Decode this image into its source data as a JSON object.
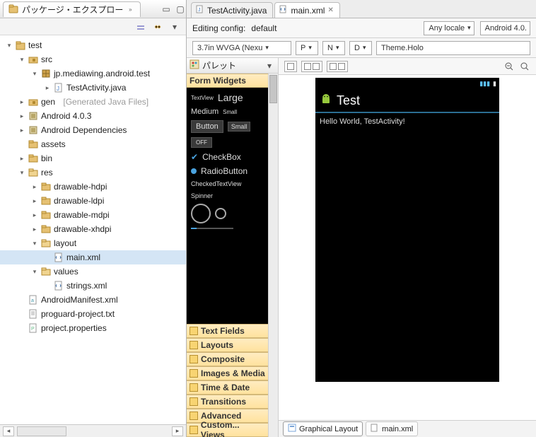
{
  "sidebar": {
    "title": "パッケージ・エクスプロー",
    "toolbar": {
      "menu": "▾"
    },
    "tree": {
      "n0": "test",
      "n1": "src",
      "n2": "jp.mediawing.android.test",
      "n3": "TestActivity.java",
      "n4": "gen",
      "n4_hint": "[Generated Java Files]",
      "n5": "Android 4.0.3",
      "n6": "Android Dependencies",
      "n7": "assets",
      "n8": "bin",
      "n9": "res",
      "n10": "drawable-hdpi",
      "n11": "drawable-ldpi",
      "n12": "drawable-mdpi",
      "n13": "drawable-xhdpi",
      "n14": "layout",
      "n15": "main.xml",
      "n16": "values",
      "n17": "strings.xml",
      "n18": "AndroidManifest.xml",
      "n19": "proguard-project.txt",
      "n20": "project.properties"
    }
  },
  "editor": {
    "tabs": {
      "t0": "TestActivity.java",
      "t1": "main.xml"
    },
    "config_label": "Editing config:",
    "config_value": "default",
    "locale": "Any locale",
    "platform": "Android 4.0.",
    "device": "3.7in WVGA (Nexu",
    "orient_p": "P",
    "orient_n": "N",
    "orient_d": "D",
    "theme": "Theme.Holo"
  },
  "palette": {
    "title": "パレット",
    "drawers": {
      "form_widgets": "Form Widgets",
      "text_fields": "Text Fields",
      "layouts": "Layouts",
      "composite": "Composite",
      "images": "Images & Media",
      "time": "Time & Date",
      "transitions": "Transitions",
      "advanced": "Advanced",
      "custom": "Custom... Views"
    },
    "widgets": {
      "textview": "TextView",
      "large": "Large",
      "medium": "Medium",
      "small": "Small",
      "button": "Button",
      "small_btn": "Small",
      "off": "OFF",
      "checkbox": "CheckBox",
      "radio": "RadioButton",
      "checked_tv": "CheckedTextView",
      "spinner": "Spinner"
    }
  },
  "canvas": {
    "app_title": "Test",
    "body_text": "Hello World, TestActivity!"
  },
  "bottom_tabs": {
    "graphical": "Graphical Layout",
    "xml": "main.xml"
  },
  "icons": {
    "project": "#cfa24a",
    "folder": "#e6c173",
    "folder_open": "#e6c173",
    "pkg": "#cfa24a",
    "java": "#4a80c7",
    "xml": "#7aa5d8",
    "txt": "#a0a0a0",
    "jar": "#c99a4a"
  }
}
